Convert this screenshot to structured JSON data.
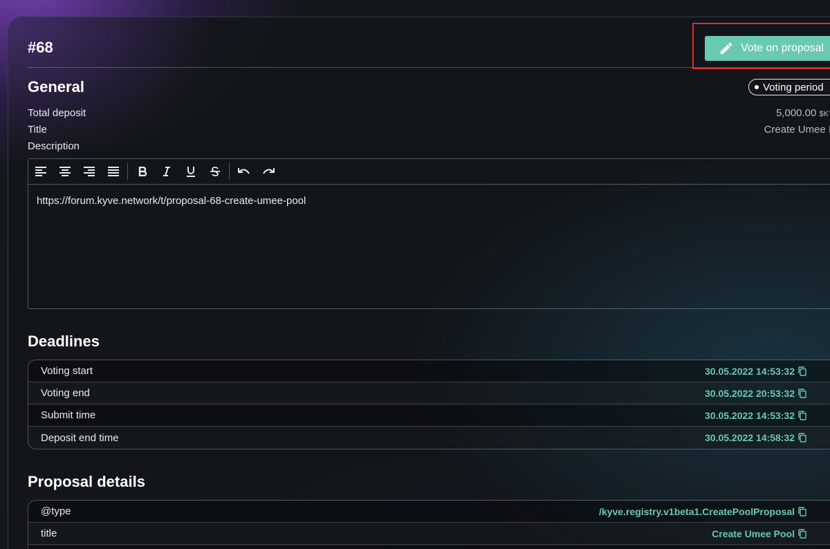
{
  "header": {
    "proposal_id": "#68",
    "vote_button_label": "Vote on proposal"
  },
  "general": {
    "title": "General",
    "status": "Voting period",
    "fields": {
      "total_deposit_label": "Total deposit",
      "total_deposit_value": "5,000.00",
      "total_deposit_unit": "$KYVE",
      "title_label": "Title",
      "title_value": "Create Umee Pool",
      "description_label": "Description"
    }
  },
  "editor": {
    "content": "https://forum.kyve.network/t/proposal-68-create-umee-pool",
    "toolbar": [
      "align-left-icon",
      "align-center-icon",
      "align-right-icon",
      "align-justify-icon",
      "bold-icon",
      "italic-icon",
      "underline-icon",
      "strikethrough-icon",
      "undo-icon",
      "redo-icon"
    ]
  },
  "deadlines": {
    "title": "Deadlines",
    "rows": [
      {
        "label": "Voting start",
        "value": "30.05.2022 14:53:32"
      },
      {
        "label": "Voting end",
        "value": "30.05.2022 20:53:32"
      },
      {
        "label": "Submit time",
        "value": "30.05.2022 14:53:32"
      },
      {
        "label": "Deposit end time",
        "value": "30.05.2022 14:58:32"
      }
    ]
  },
  "proposal_details": {
    "title": "Proposal details",
    "rows": [
      {
        "label": "@type",
        "value": "/kyve.registry.v1beta1.CreatePoolProposal"
      },
      {
        "label": "title",
        "value": "Create Umee Pool"
      }
    ]
  },
  "colors": {
    "accent": "#6ac9b3",
    "highlight": "#e0302a"
  }
}
